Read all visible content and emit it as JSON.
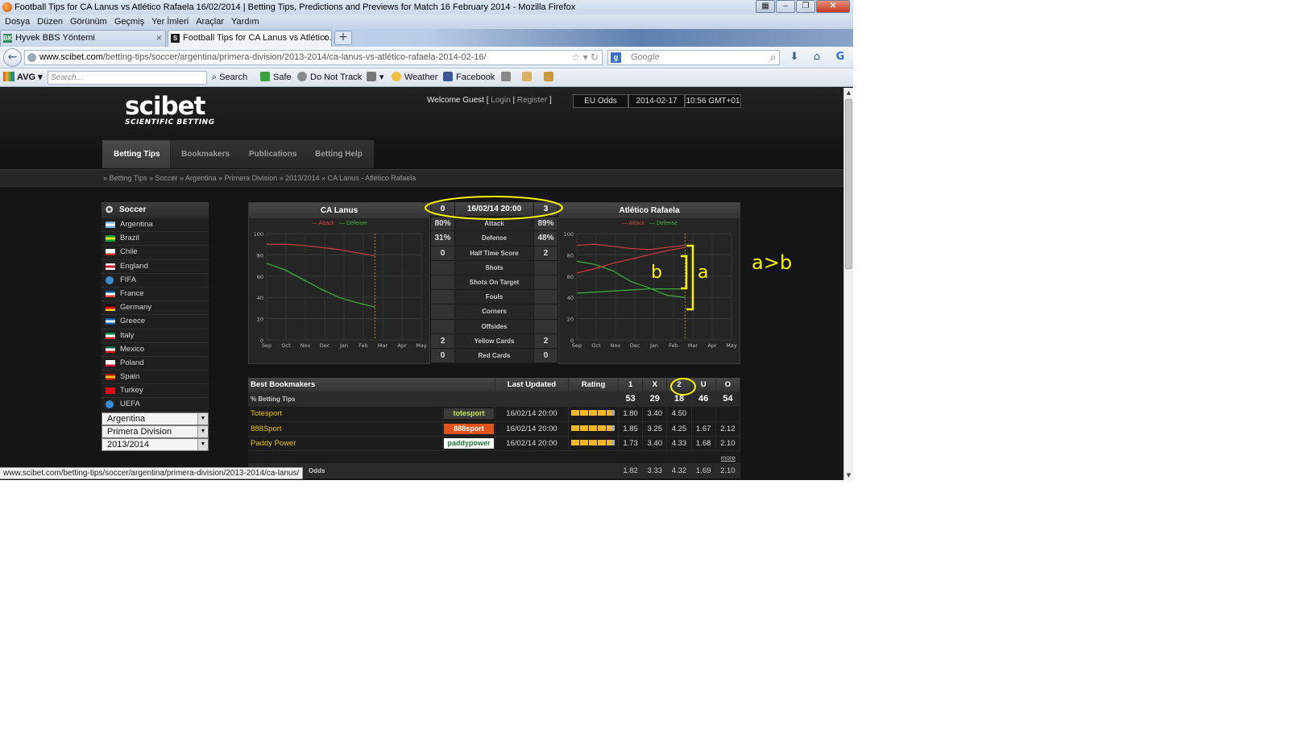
{
  "window": {
    "title": "Football Tips for CA Lanus vs Atlético Rafaela 16/02/2014 | Betting Tips, Predictions and Previews for Match 16 February 2014 - Mozilla Firefox"
  },
  "menu": [
    "Dosya",
    "Düzen",
    "Görünüm",
    "Geçmiş",
    "Yer İmleri",
    "Araçlar",
    "Yardım"
  ],
  "tabs": [
    {
      "label": "Hyvek BBS Yöntemi",
      "fav": "BK"
    },
    {
      "label": "Football Tips for CA Lanus vs Atlético...",
      "fav": "S"
    }
  ],
  "address": {
    "domain": "www.scibet.com",
    "path": "/betting-tips/soccer/argentina/primera-division/2013-2014/ca-lanus-vs-atlético-rafaela-2014-02-16/"
  },
  "search": {
    "placeholder": "Google"
  },
  "toolbar2": {
    "avg": "AVG",
    "search_placeholder": "Search...",
    "search_btn": "Search",
    "safe": "Safe",
    "dnt": "Do Not Track",
    "weather": "Weather",
    "facebook": "Facebook"
  },
  "site": {
    "logo": "scibet",
    "logo_sub": "SCIENTIFIC BETTING",
    "welcome": "Welcome Guest",
    "login": "Login",
    "register": "Register",
    "odds_format": "EU Odds",
    "date": "2014-02-17",
    "time": "10:56 GMT+01",
    "nav": [
      "Betting Tips",
      "Bookmakers",
      "Publications",
      "Betting Help"
    ],
    "breadcrumb": "» Betting Tips » Soccer » Argentina » Primera Division » 2013/2014 » CA Lanus - Atlético Rafaela"
  },
  "sidebar": {
    "title": "Soccer",
    "countries": [
      {
        "name": "Argentina",
        "flag": [
          "#74acdf",
          "#ffffff",
          "#74acdf"
        ]
      },
      {
        "name": "Brazil",
        "flag": [
          "#009c3b",
          "#ffdf00",
          "#009c3b"
        ]
      },
      {
        "name": "Chile",
        "flag": [
          "#ffffff",
          "#ffffff",
          "#d52b1e"
        ]
      },
      {
        "name": "England",
        "flag": [
          "#ffffff",
          "#ce1124",
          "#ffffff"
        ]
      },
      {
        "name": "FIFA",
        "flag": [
          "#3a8fd6",
          "#3a8fd6",
          "#3a8fd6"
        ]
      },
      {
        "name": "France",
        "flag": [
          "#0055a4",
          "#ffffff",
          "#ef4135"
        ]
      },
      {
        "name": "Germany",
        "flag": [
          "#000000",
          "#dd0000",
          "#ffce00"
        ]
      },
      {
        "name": "Greece",
        "flag": [
          "#0d5eaf",
          "#ffffff",
          "#0d5eaf"
        ]
      },
      {
        "name": "Italy",
        "flag": [
          "#009246",
          "#ffffff",
          "#ce2b37"
        ]
      },
      {
        "name": "Mexico",
        "flag": [
          "#006847",
          "#ffffff",
          "#ce1126"
        ]
      },
      {
        "name": "Poland",
        "flag": [
          "#ffffff",
          "#ffffff",
          "#dc143c"
        ]
      },
      {
        "name": "Spain",
        "flag": [
          "#aa151b",
          "#f1bf00",
          "#aa151b"
        ]
      },
      {
        "name": "Turkey",
        "flag": [
          "#e30a17",
          "#e30a17",
          "#e30a17"
        ]
      },
      {
        "name": "UEFA",
        "flag": [
          "#3a8fd6",
          "#3a8fd6",
          "#3a8fd6"
        ]
      }
    ],
    "selects": [
      "Argentina",
      "Primera Division",
      "2013/2014"
    ]
  },
  "match": {
    "home": "CA Lanus",
    "away": "Atlético Rafaela",
    "datetime": "16/02/14 20:00",
    "home_score": "0",
    "away_score": "3",
    "legend_attack": "Attack",
    "legend_defense": "Defense",
    "chart_ticks_y": [
      "100",
      "80",
      "60",
      "40",
      "20",
      "0"
    ],
    "chart_months": [
      "Sep",
      "Oct",
      "Nov",
      "Dec",
      "Jan",
      "Feb",
      "Mar",
      "Apr",
      "May"
    ],
    "stats": [
      {
        "label": "Attack",
        "home": "80%",
        "away": "89%"
      },
      {
        "label": "Defense",
        "home": "31%",
        "away": "48%"
      },
      {
        "label": "Half Time Score",
        "home": "0",
        "away": "2"
      },
      {
        "label": "Shots",
        "home": "",
        "away": ""
      },
      {
        "label": "Shots On Target",
        "home": "",
        "away": ""
      },
      {
        "label": "Fouls",
        "home": "",
        "away": ""
      },
      {
        "label": "Corners",
        "home": "",
        "away": ""
      },
      {
        "label": "Offsides",
        "home": "",
        "away": ""
      },
      {
        "label": "Yellow Cards",
        "home": "2",
        "away": "2"
      },
      {
        "label": "Red Cards",
        "home": "0",
        "away": "0"
      }
    ]
  },
  "chart_data": [
    {
      "type": "line",
      "title": "CA Lanus",
      "x": [
        "Sep",
        "Oct",
        "Nov",
        "Dec",
        "Jan",
        "Feb",
        "Mar"
      ],
      "series": [
        {
          "name": "Attack",
          "color": "#c03a3a",
          "values": [
            90,
            90,
            89,
            87,
            85,
            82,
            79
          ]
        },
        {
          "name": "Defense",
          "color": "#3aa83a",
          "values": [
            72,
            66,
            57,
            48,
            40,
            35,
            31
          ]
        }
      ],
      "ylim": [
        0,
        100
      ]
    },
    {
      "type": "line",
      "title": "Atlético Rafaela",
      "x": [
        "Sep",
        "Oct",
        "Nov",
        "Dec",
        "Jan",
        "Feb",
        "Mar"
      ],
      "series": [
        {
          "name": "Attack",
          "color": "#c03a3a",
          "values": [
            89,
            90,
            88,
            86,
            85,
            87,
            89
          ]
        },
        {
          "name": "Defense",
          "color": "#3aa83a",
          "values": [
            74,
            71,
            65,
            55,
            49,
            42,
            40
          ]
        },
        {
          "name": "Defense",
          "color": "#3aa83a",
          "values": [
            44,
            45,
            46,
            47,
            48,
            48,
            48
          ]
        },
        {
          "name": "Attack",
          "color": "#c03a3a",
          "values": [
            63,
            67,
            72,
            76,
            80,
            84,
            87
          ]
        }
      ],
      "ylim": [
        0,
        100
      ]
    }
  ],
  "bookmakers": {
    "headers": {
      "name": "Best Bookmakers",
      "updated": "Last Updated",
      "rating": "Rating",
      "c1": "1",
      "cx": "X",
      "c2": "2",
      "cu": "U",
      "co": "O"
    },
    "pct_label": "% Betting Tips",
    "pct": [
      "53",
      "29",
      "18",
      "46",
      "54"
    ],
    "rows": [
      {
        "name": "Totesport",
        "logo": "totesport",
        "logo_bg": "#3a3a3a",
        "logo_fg": "#c5e05a",
        "updated": "16/02/14 20:00",
        "stars": 4.5,
        "v": [
          "1.80",
          "3.40",
          "4.50",
          "",
          ""
        ]
      },
      {
        "name": "888Sport",
        "logo": "888sport",
        "logo_bg": "#e2531b",
        "logo_fg": "#ffffff",
        "updated": "16/02/14 20:00",
        "stars": 4.5,
        "v": [
          "1.85",
          "3.25",
          "4.25",
          "1.67",
          "2.12"
        ]
      },
      {
        "name": "Paddy Power",
        "logo": "paddypower",
        "logo_bg": "#ffffff",
        "logo_fg": "#1a7a3a",
        "updated": "16/02/14 20:00",
        "stars": 4.5,
        "v": [
          "1.73",
          "3.40",
          "4.33",
          "1.68",
          "2.10"
        ]
      }
    ],
    "more": "more",
    "avg_label": "Odds",
    "avg": [
      "1.82",
      "3.33",
      "4.32",
      "1.69",
      "2.10"
    ]
  },
  "statusbar": "www.scibet.com/betting-tips/soccer/argentina/primera-division/2013-2014/ca-lanus/",
  "annotations": {
    "b": "b",
    "a": "a",
    "note": "a>b",
    "color": "#f5f500"
  }
}
